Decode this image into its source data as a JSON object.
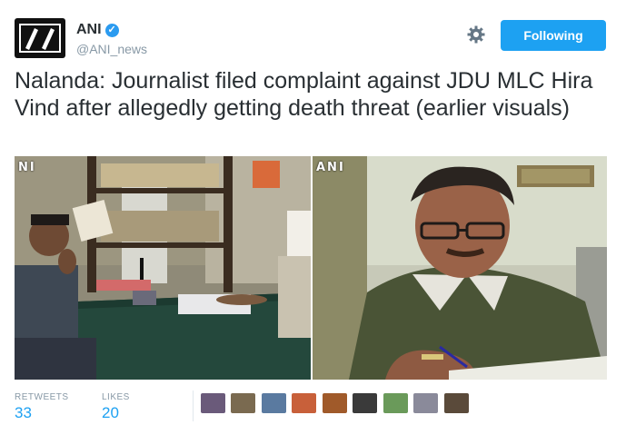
{
  "user": {
    "name": "ANI",
    "handle": "@ANI_news",
    "avatar_text": "ANI"
  },
  "actions": {
    "follow_label": "Following"
  },
  "tweet": {
    "text": "Nalanda: Journalist filed complaint against JDU MLC Hira Vind after allegedly getting death threat (earlier visuals)"
  },
  "media": {
    "left_watermark": "NI",
    "right_watermark": "ANI"
  },
  "stats": {
    "retweets_label": "RETWEETS",
    "retweets_value": "33",
    "likes_label": "LIKES",
    "likes_value": "20"
  },
  "colors": {
    "accent": "#1da1f2",
    "verified": "#2b9bf0",
    "text": "#292f33",
    "muted": "#8899a6"
  },
  "icons": {
    "settings": "gear-icon",
    "verified": "verified-badge-icon"
  }
}
